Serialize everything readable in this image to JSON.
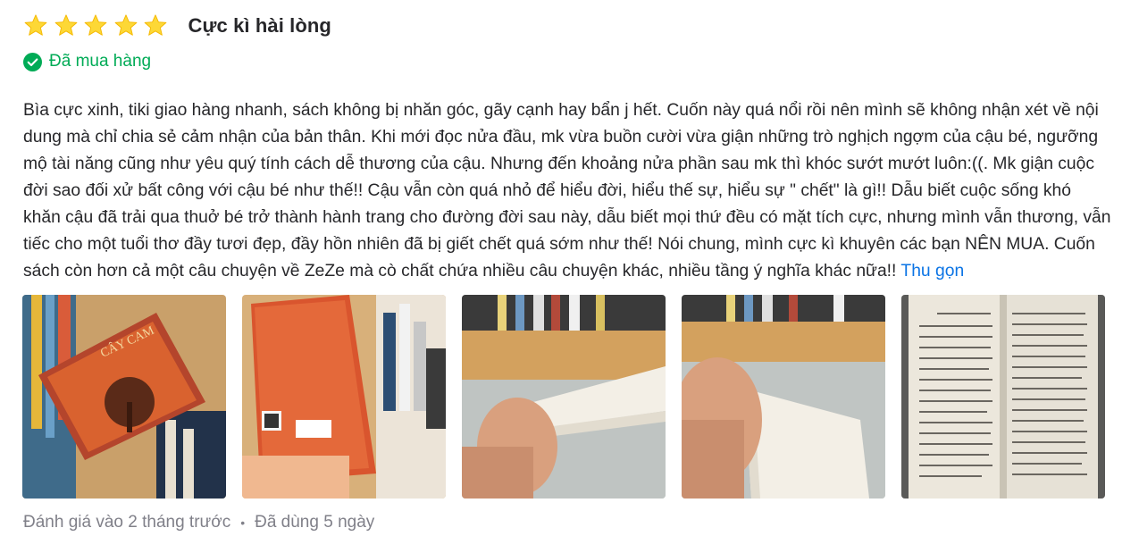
{
  "review": {
    "rating": 5,
    "rating_max": 5,
    "star_color": "#fdd836",
    "rating_title": "Cực kì hài lòng",
    "purchased_label": "Đã mua hàng",
    "purchased_color": "#00ab56",
    "content_text": "Bìa cực xinh, tiki giao hàng nhanh, sách không bị nhăn góc, gãy cạnh hay bẩn j hết. Cuốn này quá nổi rồi nên mình sẽ không nhận xét về nội dung mà chỉ chia sẻ cảm nhận của bản thân. Khi mới đọc nửa đầu, mk vừa buồn cười vừa giận những trò nghịch ngợm của cậu bé, ngưỡng mộ tài năng cũng như yêu quý tính cách dễ thương của cậu. Nhưng đến khoảng nửa phần sau mk thì khóc sướt mướt luôn:((. Mk giận cuộc đời sao đối xử bất công với cậu bé như thế!! Cậu vẫn còn quá nhỏ để hiểu đời, hiểu thế sự, hiểu sự \" chết\" là gì!! Dẫu biết cuộc sống khó khăn cậu đã trải qua thuở bé trở thành hành trang cho đường đời sau này, dẫu biết mọi thứ đều có mặt tích cực, nhưng mình vẫn thương, vẫn tiếc cho một tuổi thơ đầy tươi đẹp, đầy hồn nhiên đã bị giết chết quá sớm như thế! Nói chung, mình cực kì khuyên các bạn NÊN MUA. Cuốn sách còn hơn cả một câu chuyện về ZeZe mà cò chất chứa nhiều câu chuyện khác, nhiều tầng ý nghĩa khác nữa!!",
    "collapse_label": "Thu gọn",
    "link_color": "#0b74e5",
    "images": [
      {
        "icon": "book-cover-photo"
      },
      {
        "icon": "book-back-photo"
      },
      {
        "icon": "book-spine-photo"
      },
      {
        "icon": "book-edge-photo"
      },
      {
        "icon": "book-pages-photo"
      }
    ],
    "meta": {
      "reviewed_at": "Đánh giá vào 2 tháng trước",
      "used_for": "Đã dùng 5 ngày"
    }
  }
}
